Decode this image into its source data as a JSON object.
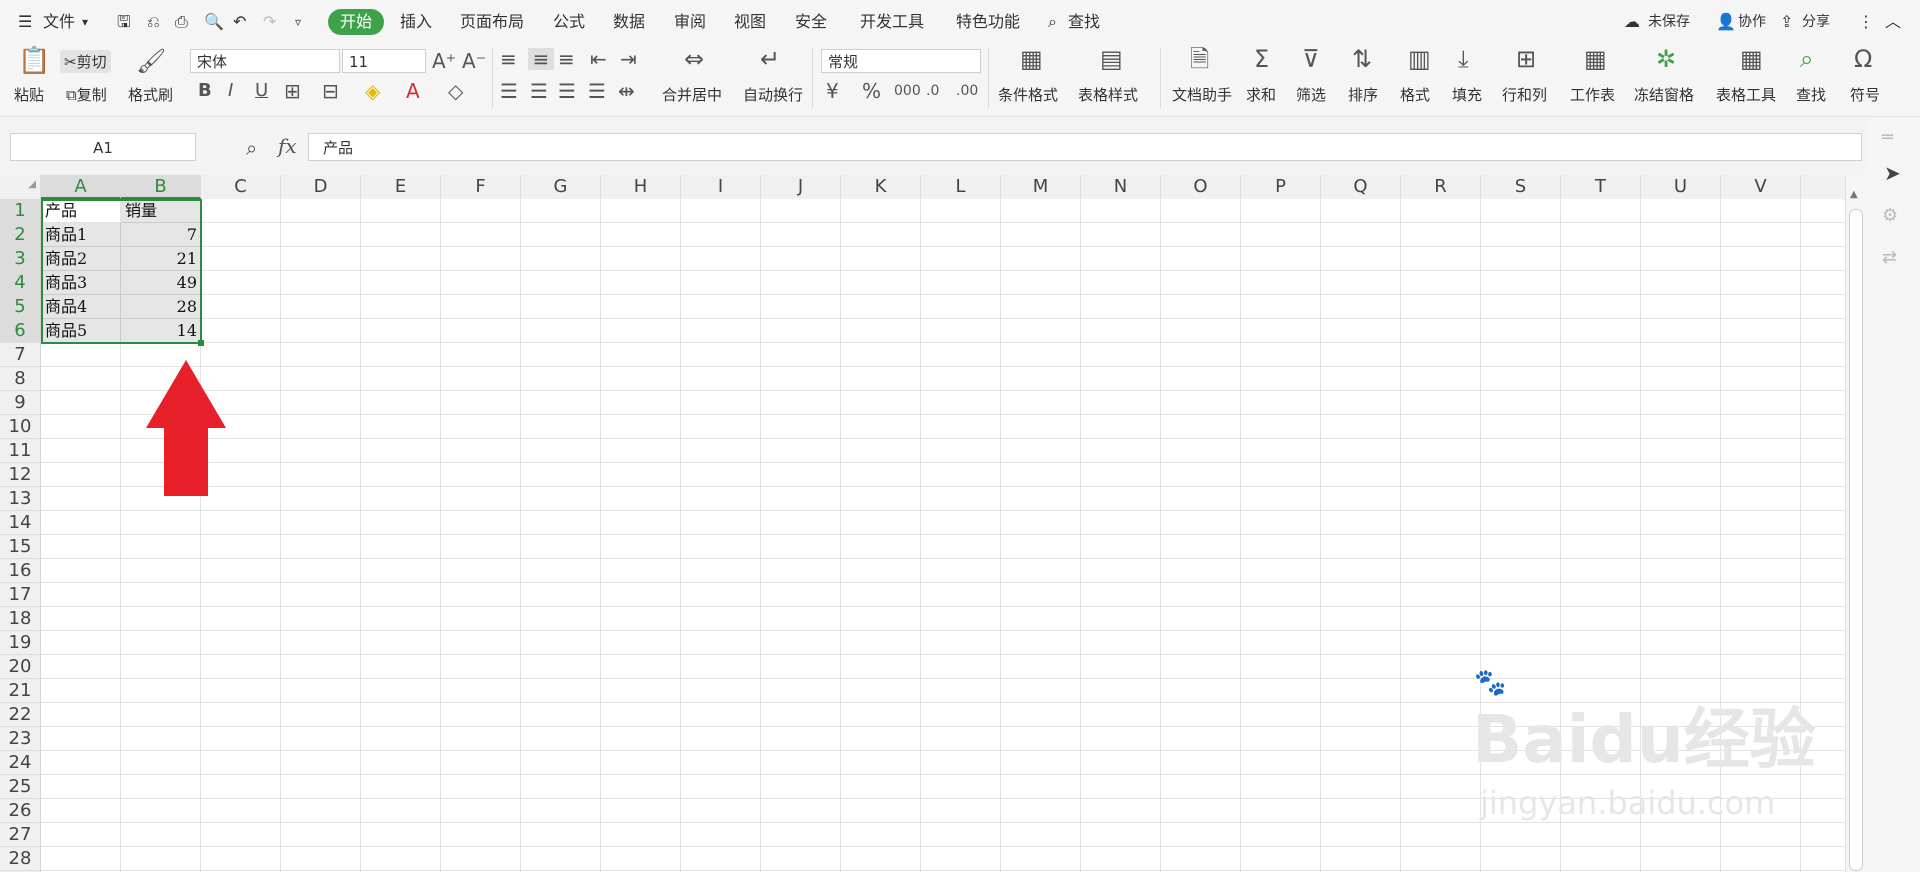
{
  "menu": {
    "file": "文件",
    "tabs": [
      "开始",
      "插入",
      "页面布局",
      "公式",
      "数据",
      "审阅",
      "视图",
      "安全",
      "开发工具",
      "特色功能"
    ],
    "active_tab": "开始",
    "search": "查找",
    "unsaved": "未保存",
    "collab": "协作",
    "share": "分享"
  },
  "ribbon": {
    "paste": "粘贴",
    "cut": "剪切",
    "copy": "复制",
    "format_painter": "格式刷",
    "font_name": "宋体",
    "font_size": "11",
    "merge_center": "合并居中",
    "wrap": "自动换行",
    "number_format": "常规",
    "cond_format": "条件格式",
    "table_style": "表格样式",
    "doc_helper": "文档助手",
    "sum": "求和",
    "filter": "筛选",
    "sort": "排序",
    "format": "格式",
    "fill": "填充",
    "row_col": "行和列",
    "worksheet": "工作表",
    "freeze": "冻结窗格",
    "table_tools": "表格工具",
    "find": "查找",
    "symbol": "符号"
  },
  "formula_bar": {
    "name_box": "A1",
    "fx": "fx",
    "content": "产品"
  },
  "grid": {
    "columns": [
      "A",
      "B",
      "C",
      "D",
      "E",
      "F",
      "G",
      "H",
      "I",
      "J",
      "K",
      "L",
      "M",
      "N",
      "O",
      "P",
      "Q",
      "R",
      "S",
      "T",
      "U",
      "V"
    ],
    "rows": [
      "1",
      "2",
      "3",
      "4",
      "5",
      "6",
      "7",
      "8",
      "9",
      "10",
      "11",
      "12",
      "13",
      "14",
      "15",
      "16",
      "17",
      "18",
      "19",
      "20",
      "21",
      "22",
      "23",
      "24",
      "25",
      "26",
      "27",
      "28"
    ],
    "data": [
      [
        "产品",
        "销量"
      ],
      [
        "商品1",
        "7"
      ],
      [
        "商品2",
        "21"
      ],
      [
        "商品3",
        "49"
      ],
      [
        "商品4",
        "28"
      ],
      [
        "商品5",
        "14"
      ]
    ]
  },
  "watermark": {
    "brand": "Baidu经验",
    "url": "jingyan.baidu.com"
  },
  "colors": {
    "accent": "#3fa24a",
    "arrow": "#e8202a"
  }
}
